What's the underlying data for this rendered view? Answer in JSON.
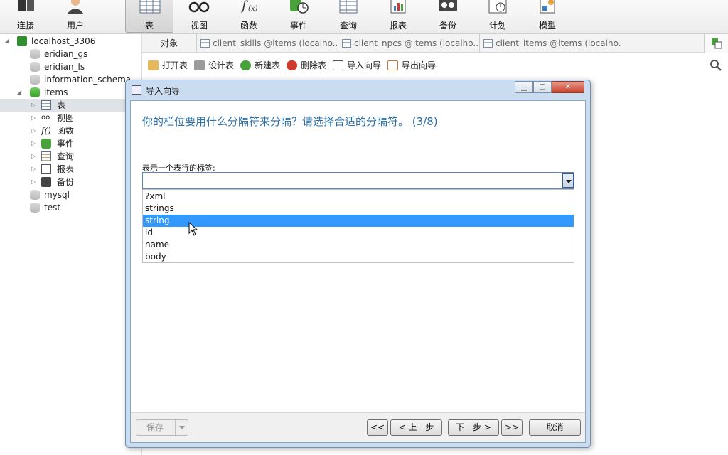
{
  "toolbar": {
    "items": [
      {
        "label": "连接",
        "icon": "plug-icon"
      },
      {
        "label": "用户",
        "icon": "user-icon"
      },
      {
        "label": "表",
        "icon": "table-icon",
        "active": true
      },
      {
        "label": "视图",
        "icon": "glasses-icon"
      },
      {
        "label": "函数",
        "icon": "function-icon"
      },
      {
        "label": "事件",
        "icon": "event-clock-icon"
      },
      {
        "label": "查询",
        "icon": "query-icon"
      },
      {
        "label": "报表",
        "icon": "report-icon"
      },
      {
        "label": "备份",
        "icon": "backup-icon"
      },
      {
        "label": "计划",
        "icon": "schedule-icon"
      },
      {
        "label": "模型",
        "icon": "model-icon"
      }
    ]
  },
  "tree": {
    "connection": "localhost_3306",
    "databases": [
      "eridian_gs",
      "eridian_ls",
      "information_schema",
      "items",
      "mysql",
      "test"
    ],
    "items_children": [
      {
        "label": "表",
        "icon": "table-icon"
      },
      {
        "label": "视图",
        "icon": "glasses-icon"
      },
      {
        "label": "函数",
        "icon": "function-icon"
      },
      {
        "label": "事件",
        "icon": "event-clock-icon"
      },
      {
        "label": "查询",
        "icon": "query-icon"
      },
      {
        "label": "报表",
        "icon": "report-icon"
      },
      {
        "label": "备份",
        "icon": "backup-icon"
      }
    ]
  },
  "objbar": {
    "label": "对象",
    "tabs": [
      "client_skills @items (localho...",
      "client_npcs @items (localho...",
      "client_items @items (localho..."
    ]
  },
  "subbar": {
    "buttons": [
      "打开表",
      "设计表",
      "新建表",
      "删除表",
      "导入向导",
      "导出向导"
    ]
  },
  "dialog": {
    "title": "导入向导",
    "question": "你的栏位要用什么分隔符来分隔？请选择合适的分隔符。 (3/8)",
    "field_label": "表示一个表行的标签:",
    "combo_value": "",
    "options": [
      "?xml",
      "strings",
      "string",
      "id",
      "name",
      "body"
    ],
    "highlighted_option": "string",
    "buttons": {
      "save": "保存",
      "first": "<<",
      "prev": "< 上一步",
      "next": "下一步 >",
      "last": ">>",
      "cancel": "取消"
    }
  },
  "colors": {
    "accent": "#2a6fa8",
    "selection": "#3399ff",
    "dialog_frame": "#c9dcf0"
  }
}
